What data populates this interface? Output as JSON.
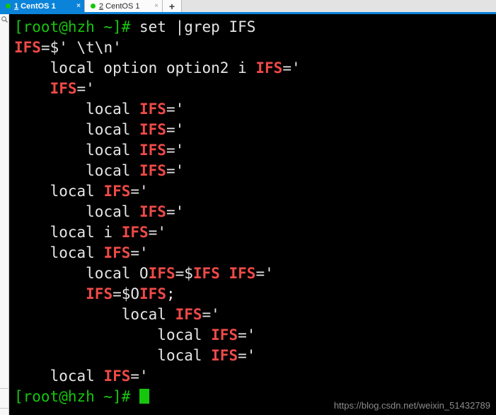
{
  "window": {
    "app_title": "CentOS terminal tabs"
  },
  "tabbar": {
    "tabs": [
      {
        "accelerator": "1",
        "name": " CentOS 1",
        "full_label": "1 CentOS 1",
        "status_color": "#16c60c",
        "active": true,
        "close_glyph": "×"
      },
      {
        "accelerator": "2",
        "name": " CentOS 1",
        "full_label": "2 CentOS 1",
        "status_color": "#16c60c",
        "active": false,
        "close_glyph": "×"
      }
    ],
    "new_tab_glyph": "+",
    "accent_color": "#0b83d9"
  },
  "rail": {
    "icon": "search-icon"
  },
  "terminal": {
    "colors": {
      "background": "#000000",
      "foreground": "#e6e6e6",
      "prompt": "#16c60c",
      "match": "#f04a48",
      "cursor": "#16c60c"
    },
    "prompt_text": "[root@hzh ~]# ",
    "command": "set |grep IFS",
    "lines": [
      {
        "type": "prompt",
        "prompt": "[root@hzh ~]# ",
        "command": "set |grep IFS"
      },
      {
        "type": "out",
        "indent": "",
        "pre": "",
        "match": "IFS",
        "post": "=$' \\t\\n'"
      },
      {
        "type": "out",
        "indent": "    ",
        "pre": "local option option2 i ",
        "match": "IFS",
        "post": "='"
      },
      {
        "type": "out",
        "indent": "    ",
        "pre": "",
        "match": "IFS",
        "post": "='"
      },
      {
        "type": "out",
        "indent": "        ",
        "pre": "local ",
        "match": "IFS",
        "post": "='"
      },
      {
        "type": "out",
        "indent": "        ",
        "pre": "local ",
        "match": "IFS",
        "post": "='"
      },
      {
        "type": "out",
        "indent": "        ",
        "pre": "local ",
        "match": "IFS",
        "post": "='"
      },
      {
        "type": "out",
        "indent": "        ",
        "pre": "local ",
        "match": "IFS",
        "post": "='"
      },
      {
        "type": "out",
        "indent": "    ",
        "pre": "local ",
        "match": "IFS",
        "post": "='"
      },
      {
        "type": "out",
        "indent": "        ",
        "pre": "local ",
        "match": "IFS",
        "post": "='"
      },
      {
        "type": "out",
        "indent": "    ",
        "pre": "local i ",
        "match": "IFS",
        "post": "='"
      },
      {
        "type": "out",
        "indent": "    ",
        "pre": "local ",
        "match": "IFS",
        "post": "='"
      },
      {
        "type": "out_multi",
        "indent": "        ",
        "parts": [
          {
            "text": "local O",
            "kind": "white"
          },
          {
            "text": "IFS",
            "kind": "match"
          },
          {
            "text": "=$",
            "kind": "white"
          },
          {
            "text": "IFS",
            "kind": "match"
          },
          {
            "text": " ",
            "kind": "white"
          },
          {
            "text": "IFS",
            "kind": "match"
          },
          {
            "text": "='",
            "kind": "white"
          }
        ]
      },
      {
        "type": "out_multi",
        "indent": "        ",
        "parts": [
          {
            "text": "IFS",
            "kind": "match"
          },
          {
            "text": "=$O",
            "kind": "white"
          },
          {
            "text": "IFS",
            "kind": "match"
          },
          {
            "text": ";",
            "kind": "white"
          }
        ]
      },
      {
        "type": "out",
        "indent": "            ",
        "pre": "local ",
        "match": "IFS",
        "post": "='"
      },
      {
        "type": "out",
        "indent": "                ",
        "pre": "local ",
        "match": "IFS",
        "post": "='"
      },
      {
        "type": "out",
        "indent": "                ",
        "pre": "local ",
        "match": "IFS",
        "post": "='"
      },
      {
        "type": "out",
        "indent": "    ",
        "pre": "local ",
        "match": "IFS",
        "post": "='"
      },
      {
        "type": "prompt_cursor",
        "prompt": "[root@hzh ~]# "
      }
    ]
  },
  "watermark": {
    "text": "https://blog.csdn.net/weixin_51432789"
  }
}
